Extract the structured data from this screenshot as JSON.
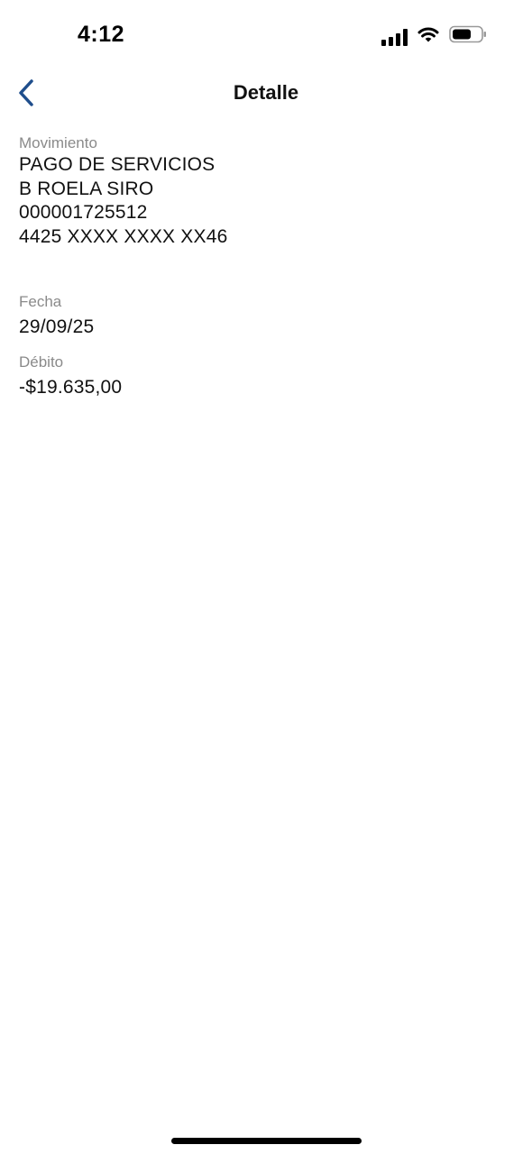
{
  "status_bar": {
    "time": "4:12",
    "icons": [
      "cellular-signal-icon",
      "wifi-icon",
      "battery-icon"
    ]
  },
  "nav": {
    "back_icon": "chevron-left-icon",
    "title": "Detalle",
    "accent_color": "#1f4e8c"
  },
  "details": {
    "movimiento": {
      "label": "Movimiento",
      "lines": [
        "PAGO DE SERVICIOS",
        "B ROELA SIRO",
        "000001725512",
        "4425 XXXX XXXX XX46"
      ]
    },
    "fecha": {
      "label": "Fecha",
      "value": "29/09/25"
    },
    "debito": {
      "label": "Débito",
      "value": "-$19.635,00"
    }
  }
}
